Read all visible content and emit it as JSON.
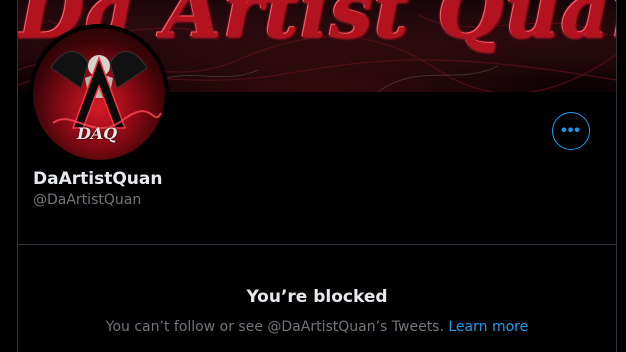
{
  "banner": {
    "text": "Da Artist Quan"
  },
  "avatar": {
    "text": "DAQ"
  },
  "profile": {
    "display_name": "DaArtistQuan",
    "handle": "@DaArtistQuan",
    "more_icon": "more-horizontal-icon",
    "more_label": "•••"
  },
  "blocked": {
    "title": "You’re blocked",
    "message": "You can’t follow or see @DaArtistQuan’s Tweets.",
    "learn_more": "Learn more"
  },
  "colors": {
    "background": "#000000",
    "accent": "#1d9bf0",
    "secondary_text": "#71767b",
    "primary_text": "#e7e9ea",
    "border": "#2f3336"
  }
}
